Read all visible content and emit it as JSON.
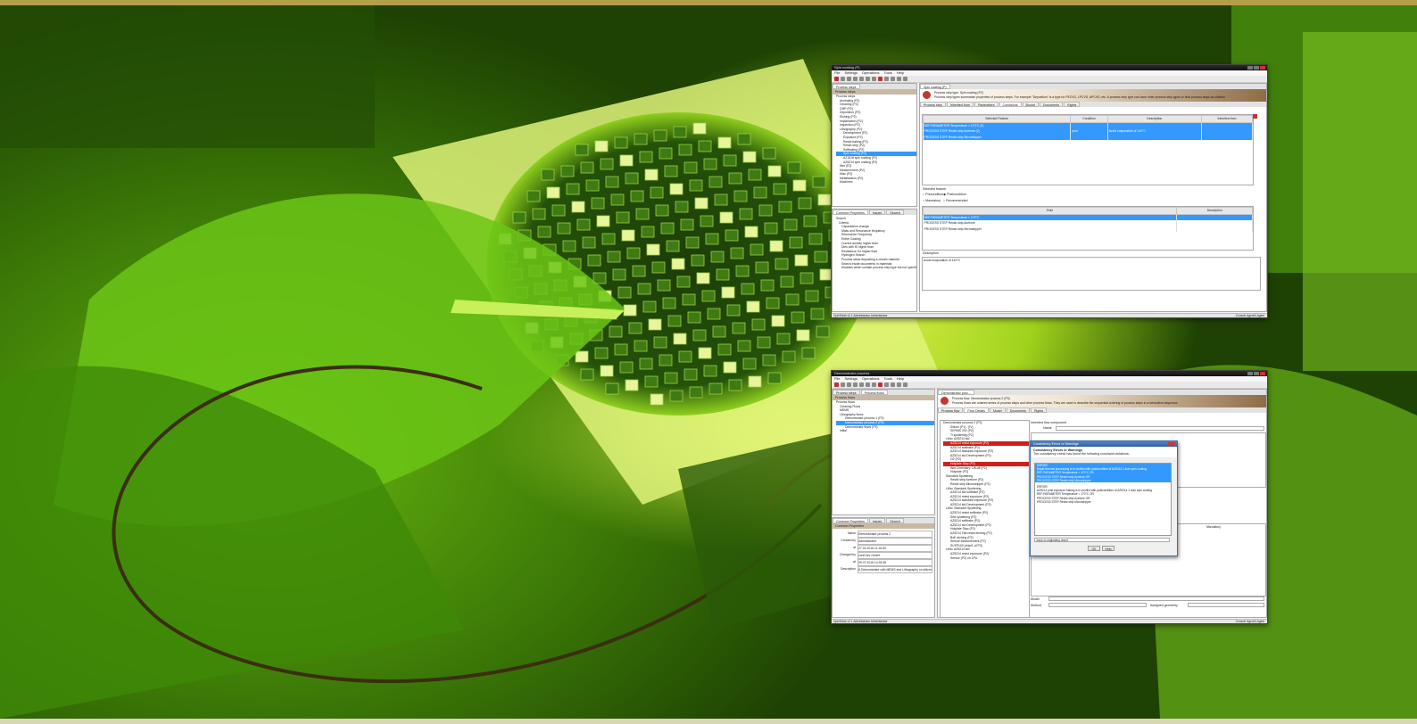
{
  "screenshot_top": {
    "title": "Spin coating (P)",
    "menu": [
      "File",
      "Settings",
      "Operations",
      "Tools",
      "Help"
    ],
    "left_tab": "Process steps",
    "tree_header": "Process steps",
    "tree": [
      "Process steps",
      "Annealing (P2)",
      "Cleaning (P2)",
      "CMP (P2)",
      "Deposition (P2)",
      "Etching (P2)",
      "Implantation (P2)",
      "Inspection (P2)",
      "Lithography (P2)",
      "Development (P2)",
      "Exposure (P2)",
      "Resist baking (P2)",
      "Resist strip (P2)",
      "Softbaking (P2)",
      "Spin coating (P2)",
      "AZ1518 spin coating (P2)",
      "AZ5214 spin coating (P2)",
      "Wet (P2)",
      "Measurement (P2)",
      "Misc (P2)",
      "Metallization (P2)",
      "Machines"
    ],
    "bottom_tabs": [
      "Common Properties",
      "Issues",
      "Search"
    ],
    "search_header": "Search",
    "search_items": [
      "Search",
      "Criteria",
      "Capacitance change",
      "Mass and Resonance frequency",
      "Resonance Frequency",
      "Entire Coating",
      "Current density higher than",
      "Dies with ID higher than",
      "Resistance Go higher than",
      "Hydrogen Search",
      "Process steps depositing a certain material",
      "Search inside documents in materials",
      "Modules which contain process step type but not specified"
    ],
    "editor_tab": "Spin coating (P)",
    "banner_line1": "Process step type: Spin coating (P2)",
    "banner_line2": "Process step types summarize properties of process steps. For example \"Deposition\" is a type for PECVD, LPCVD, APCVD, etc. A process step type can have other process step types or final process steps as children.",
    "editor_tabs": [
      "Process step",
      "Inherited from",
      "Parameters",
      "Conditions",
      "Bound",
      "Documents",
      "Rights"
    ],
    "table_headers": [
      "Selected Feature",
      "Condition",
      "Description",
      "Inherited from"
    ],
    "table_rows": [
      [
        "REF:PARAMETER Temperature < 170°C (2)",
        "",
        "",
        ""
      ],
      [
        "PROCESS STEP Resist strip Acetone (2)",
        "prior",
        "Avoid evaporation of 140°C",
        ""
      ],
      [
        "PROCESS STEP Resist strip Microstripper",
        "",
        "",
        ""
      ]
    ],
    "selected_feature_label": "Selected feature",
    "options": [
      "Precondition",
      "Postcondition",
      "Mandatory",
      "Recommended"
    ],
    "rule_headers": [
      "Rule",
      "Description"
    ],
    "rule_rows": [
      "REF:PARAMETER Temperature < 170°C",
      "PROCESS STEP Resist strip Acetone",
      "PROCESS STEP Resist strip Microstripper"
    ],
    "description_label": "Description",
    "description_text": "Avoid evaporation of 140°C",
    "status_left": "XperiDesk v2.1   Administrator   Administrator",
    "status_right": "Consult: AgentX-Agent"
  },
  "screenshot_bottom": {
    "title": "Demonstrator process",
    "menu": [
      "File",
      "Settings",
      "Operations",
      "Tools",
      "Help"
    ],
    "left_tabs": [
      "Process steps",
      "Process flows"
    ],
    "tree_header": "Process flows",
    "tree": [
      "Process flows",
      "Cleaning Flows",
      "MEMS",
      "Lithography flows",
      "Demonstrator process 1 (P3)",
      "Demonstrator process 2 (P3)",
      "Demonstrator flows (P3)",
      "Initial"
    ],
    "bottom_tabs": [
      "Common Properties",
      "Issues",
      "Search"
    ],
    "props_header": "Common Properties",
    "props": [
      {
        "label": "Name",
        "value": "Demonstrator process 2"
      },
      {
        "label": "Created by",
        "value": "Administrator"
      },
      {
        "label": "at",
        "value": "27.01.2016 11:16:50"
      },
      {
        "label": "Changed by",
        "value": "conf.Dev GmbH"
      },
      {
        "label": "at",
        "value": "09.07.2016 14:33:36"
      },
      {
        "label": "Description",
        "value": "A Demonstrator with MEMS and Lithography on silicon wafer"
      }
    ],
    "editor_tab": "Demonstrator proc...",
    "banner_line1": "Process flow: Demonstrator process 2 (P3)",
    "banner_line2": "Process flows are ordered series of process steps and other process flows. They are used to describe the sequential ordering of process steps in a fabrication sequence.",
    "editor_tabs": [
      "Process flow",
      "Flow Details",
      "Model",
      "Documents",
      "Rights"
    ],
    "flow_tree": [
      "Demonstrator process 2 (P3)",
      "Silicon (P1) - [IV]",
      "SERMS 200 (P2)",
      "Ti sputtering (P2)",
      "Litho: AZ5214 std",
      "AZ5214 resist exposure (P2)",
      "AZ5214 softbake (P2)",
      "AZ5214 standard exposure (P2)",
      "AZ5214 std Development (P2)",
      "O2 (P2)",
      "Hotplate Stop (P2)",
      "Wet Chemistry: Lift-off (P2)",
      "Hotplate (P2)",
      "Standard Sputtering",
      "Resist strip Acetone (P2)",
      "Resist strip Microstripper (P2)",
      "Litho: Standard Sputtering",
      "AZ5214 std softbake (P2)",
      "AZ5214 resist exposure (P2)",
      "AZ5214 standard exposure (P2)",
      "AZ5214 std Development (P2)",
      "Litho: Standard Sputtering",
      "AZ5214 resist softbake (P2)",
      "SiNi sputtering (P2)",
      "AZ5214 softbake (P2)",
      "AZ5214 std Development (P2)",
      "Hotplate Stop (P2)",
      "AZ5214 Flat resist etching (P2)",
      "BoE etching (P2)",
      "Sensor Measurement (P2)",
      "SUFP100 (chip/1 of P3)",
      "Litho: AZ5214 std",
      "AZ5214 resist exposure (P2)",
      "Sensor (P2) on 1PU"
    ],
    "right_label_1": "Inherited flow component",
    "right_field_1": "Name",
    "right_label_2": "Mandatory",
    "right_field_model": "Model",
    "right_field_method": "Method",
    "right_field_geom": "Assigned geometry",
    "dialog_title": "Consistency Errors or Warnings",
    "dialog_header": "Consistency Errors or Warnings",
    "dialog_sub": "The consistency check has found the following constraint violations:",
    "msg_top": [
      "ERROR:",
      "Rapid thermal processing is in conflict with postcondition of AZ5214 1.4um spin coating",
      "REF:PARAMETER Temperature < 170°C OR",
      "PROCESS STEP Resist strip Acetone OR",
      "PROCESS STEP Resist strip Microstripper"
    ],
    "msg_bottom": [
      "ERROR:",
      "AZ5214 post exposure baking is in conflict with postcondition of AZ5214 1.4um spin coating",
      "REF:PARAMETER Temperature < 170°C OR",
      "PROCESS STEP Resist strip Acetone OR",
      "PROCESS STEP Resist strip Microstripper"
    ],
    "jump_label": "Jump to originating result",
    "ok_label": "OK",
    "help_label": "Help",
    "status_left": "XperiDesk v2.1   Administrator   Administrator",
    "status_right": "Consult: AgentX-Agent"
  },
  "colors": {
    "accent_top_bar": "#b5a04a",
    "selection": "#3399ff",
    "error_red": "#d0201b",
    "photo_green": "#4e9a0c"
  }
}
